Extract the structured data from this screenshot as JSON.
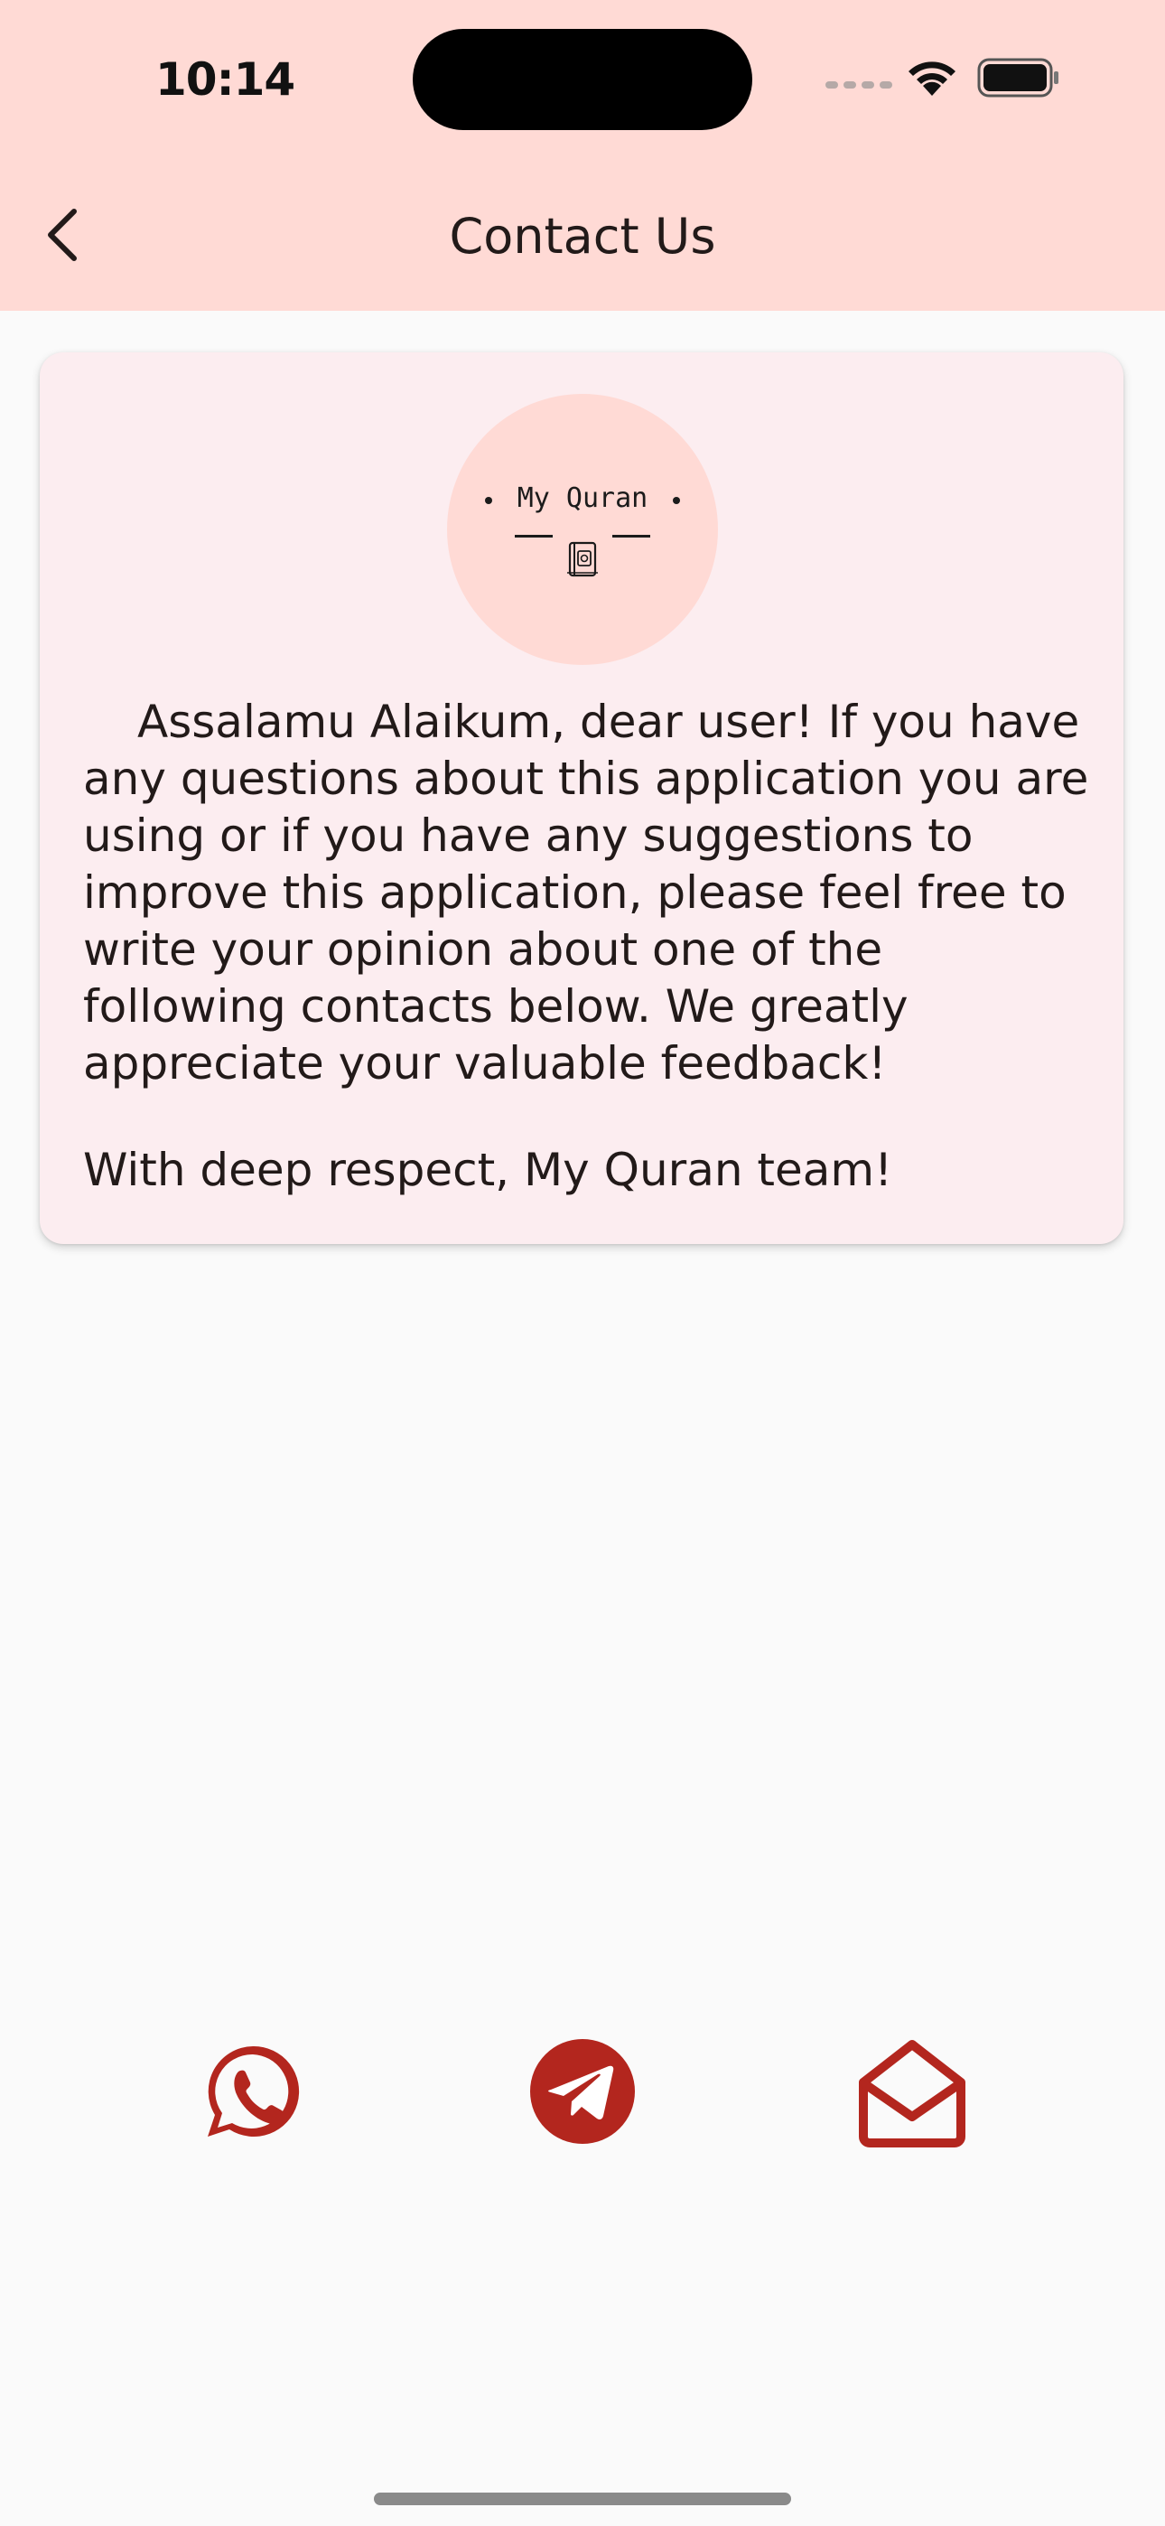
{
  "status_bar": {
    "time": "10:14"
  },
  "header": {
    "title": "Contact Us",
    "back_icon": "chevron-left-icon"
  },
  "card": {
    "logo_text": "My Quran",
    "logo_icon": "quran-book-icon",
    "message": "Assalamu Alaikum, dear user! If you have any questions about this application you are using or if you have any suggestions to improve this application, please feel free to write your opinion about one of the following contacts below. We greatly appreciate your valuable feedback!",
    "signoff": "With deep respect, My Quran team!"
  },
  "contacts": [
    {
      "icon": "whatsapp-icon"
    },
    {
      "icon": "telegram-icon"
    },
    {
      "icon": "email-icon"
    }
  ],
  "colors": {
    "header_bg": "#ffdad5",
    "card_bg": "#fcedf0",
    "page_bg": "#fafafa",
    "accent": "#b3261e",
    "text": "#221a19"
  }
}
